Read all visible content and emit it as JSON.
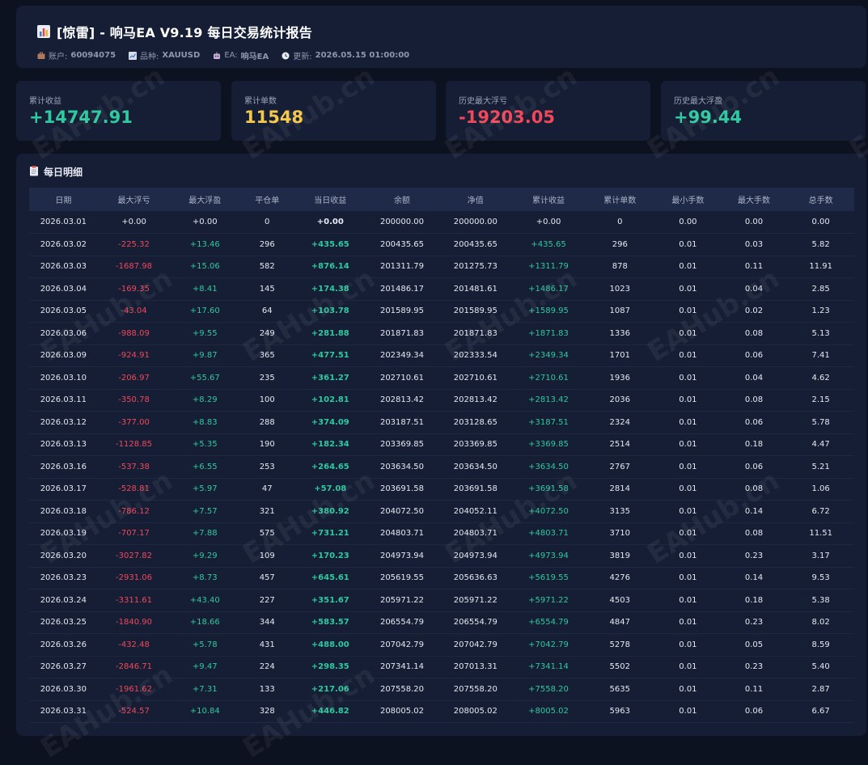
{
  "header": {
    "title": "[惊雷] - 响马EA V9.19 每日交易统计报告",
    "account_label": "账户:",
    "account_value": "60094075",
    "symbol_label": "品种:",
    "symbol_value": "XAUUSD",
    "ea_label": "EA:",
    "ea_value": "响马EA",
    "update_label": "更新:",
    "update_value": "2026.05.15 01:00:00"
  },
  "cards": [
    {
      "label": "累计收益",
      "value": "+14747.91",
      "color": "#2fc9a0"
    },
    {
      "label": "累计单数",
      "value": "11548",
      "color": "#f4c84a"
    },
    {
      "label": "历史最大浮亏",
      "value": "-19203.05",
      "color": "#f0485a"
    },
    {
      "label": "历史最大浮盈",
      "value": "+99.44",
      "color": "#2fc9a0"
    }
  ],
  "detail": {
    "title": "每日明细",
    "columns": [
      "日期",
      "最大浮亏",
      "最大浮盈",
      "平仓单",
      "当日收益",
      "余额",
      "净值",
      "累计收益",
      "累计单数",
      "最小手数",
      "最大手数",
      "总手数"
    ],
    "rows": [
      [
        "2026.03.01",
        "+0.00",
        "+0.00",
        "0",
        "+0.00",
        "200000.00",
        "200000.00",
        "+0.00",
        "0",
        "0.00",
        "0.00",
        "0.00"
      ],
      [
        "2026.03.02",
        "-225.32",
        "+13.46",
        "296",
        "+435.65",
        "200435.65",
        "200435.65",
        "+435.65",
        "296",
        "0.01",
        "0.03",
        "5.82"
      ],
      [
        "2026.03.03",
        "-1687.98",
        "+15.06",
        "582",
        "+876.14",
        "201311.79",
        "201275.73",
        "+1311.79",
        "878",
        "0.01",
        "0.11",
        "11.91"
      ],
      [
        "2026.03.04",
        "-169.35",
        "+8.41",
        "145",
        "+174.38",
        "201486.17",
        "201481.61",
        "+1486.17",
        "1023",
        "0.01",
        "0.04",
        "2.85"
      ],
      [
        "2026.03.05",
        "-43.04",
        "+17.60",
        "64",
        "+103.78",
        "201589.95",
        "201589.95",
        "+1589.95",
        "1087",
        "0.01",
        "0.02",
        "1.23"
      ],
      [
        "2026.03.06",
        "-988.09",
        "+9.55",
        "249",
        "+281.88",
        "201871.83",
        "201871.83",
        "+1871.83",
        "1336",
        "0.01",
        "0.08",
        "5.13"
      ],
      [
        "2026.03.09",
        "-924.91",
        "+9.87",
        "365",
        "+477.51",
        "202349.34",
        "202333.54",
        "+2349.34",
        "1701",
        "0.01",
        "0.06",
        "7.41"
      ],
      [
        "2026.03.10",
        "-206.97",
        "+55.67",
        "235",
        "+361.27",
        "202710.61",
        "202710.61",
        "+2710.61",
        "1936",
        "0.01",
        "0.04",
        "4.62"
      ],
      [
        "2026.03.11",
        "-350.78",
        "+8.29",
        "100",
        "+102.81",
        "202813.42",
        "202813.42",
        "+2813.42",
        "2036",
        "0.01",
        "0.08",
        "2.15"
      ],
      [
        "2026.03.12",
        "-377.00",
        "+8.83",
        "288",
        "+374.09",
        "203187.51",
        "203128.65",
        "+3187.51",
        "2324",
        "0.01",
        "0.06",
        "5.78"
      ],
      [
        "2026.03.13",
        "-1128.85",
        "+5.35",
        "190",
        "+182.34",
        "203369.85",
        "203369.85",
        "+3369.85",
        "2514",
        "0.01",
        "0.18",
        "4.47"
      ],
      [
        "2026.03.16",
        "-537.38",
        "+6.55",
        "253",
        "+264.65",
        "203634.50",
        "203634.50",
        "+3634.50",
        "2767",
        "0.01",
        "0.06",
        "5.21"
      ],
      [
        "2026.03.17",
        "-528.81",
        "+5.97",
        "47",
        "+57.08",
        "203691.58",
        "203691.58",
        "+3691.58",
        "2814",
        "0.01",
        "0.08",
        "1.06"
      ],
      [
        "2026.03.18",
        "-786.12",
        "+7.57",
        "321",
        "+380.92",
        "204072.50",
        "204052.11",
        "+4072.50",
        "3135",
        "0.01",
        "0.14",
        "6.72"
      ],
      [
        "2026.03.19",
        "-707.17",
        "+7.88",
        "575",
        "+731.21",
        "204803.71",
        "204803.71",
        "+4803.71",
        "3710",
        "0.01",
        "0.08",
        "11.51"
      ],
      [
        "2026.03.20",
        "-3027.82",
        "+9.29",
        "109",
        "+170.23",
        "204973.94",
        "204973.94",
        "+4973.94",
        "3819",
        "0.01",
        "0.23",
        "3.17"
      ],
      [
        "2026.03.23",
        "-2931.06",
        "+8.73",
        "457",
        "+645.61",
        "205619.55",
        "205636.63",
        "+5619.55",
        "4276",
        "0.01",
        "0.14",
        "9.53"
      ],
      [
        "2026.03.24",
        "-3311.61",
        "+43.40",
        "227",
        "+351.67",
        "205971.22",
        "205971.22",
        "+5971.22",
        "4503",
        "0.01",
        "0.18",
        "5.38"
      ],
      [
        "2026.03.25",
        "-1840.90",
        "+18.66",
        "344",
        "+583.57",
        "206554.79",
        "206554.79",
        "+6554.79",
        "4847",
        "0.01",
        "0.23",
        "8.02"
      ],
      [
        "2026.03.26",
        "-432.48",
        "+5.78",
        "431",
        "+488.00",
        "207042.79",
        "207042.79",
        "+7042.79",
        "5278",
        "0.01",
        "0.05",
        "8.59"
      ],
      [
        "2026.03.27",
        "-2846.71",
        "+9.47",
        "224",
        "+298.35",
        "207341.14",
        "207013.31",
        "+7341.14",
        "5502",
        "0.01",
        "0.23",
        "5.40"
      ],
      [
        "2026.03.30",
        "-1961.62",
        "+7.31",
        "133",
        "+217.06",
        "207558.20",
        "207558.20",
        "+7558.20",
        "5635",
        "0.01",
        "0.11",
        "2.87"
      ],
      [
        "2026.03.31",
        "-524.57",
        "+10.84",
        "328",
        "+446.82",
        "208005.02",
        "208005.02",
        "+8005.02",
        "5963",
        "0.01",
        "0.06",
        "6.67"
      ]
    ]
  },
  "watermark": "EAHub.cn",
  "colors": {
    "positive": "#2fc9a0",
    "negative": "#f0485a",
    "neutral": "#e6e9f2"
  }
}
